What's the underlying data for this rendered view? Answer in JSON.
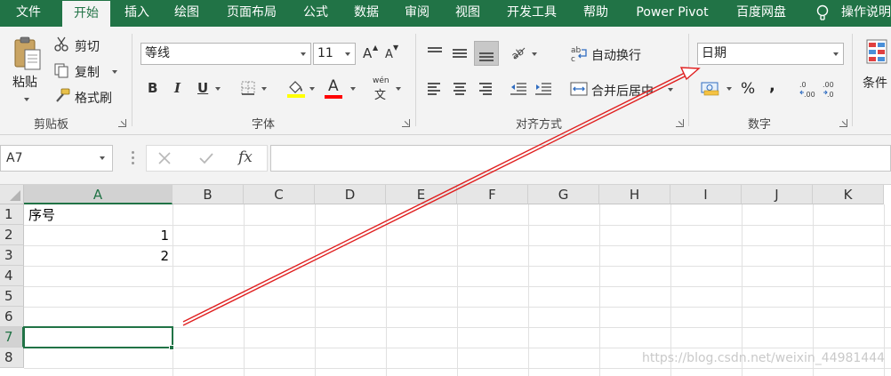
{
  "menu": {
    "tabs": [
      {
        "label": "文件"
      },
      {
        "label": "开始"
      },
      {
        "label": "插入"
      },
      {
        "label": "绘图"
      },
      {
        "label": "页面布局"
      },
      {
        "label": "公式"
      },
      {
        "label": "数据"
      },
      {
        "label": "审阅"
      },
      {
        "label": "视图"
      },
      {
        "label": "开发工具"
      },
      {
        "label": "帮助"
      },
      {
        "label": "Power Pivot"
      },
      {
        "label": "百度网盘"
      }
    ],
    "active_tab": "开始",
    "tell_me": "操作说明",
    "tell_me_icon": "lightbulb-icon"
  },
  "ribbon": {
    "clipboard": {
      "paste_label": "粘贴",
      "cut_label": "剪切",
      "copy_label": "复制",
      "format_painter_label": "格式刷",
      "group_label": "剪贴板"
    },
    "font": {
      "font_name": "等线",
      "font_size": "11",
      "grow_label": "A",
      "shrink_label": "A",
      "bold": "B",
      "italic": "I",
      "underline": "U",
      "font_color_letter": "A",
      "phonetic_top": "wén",
      "phonetic_bottom": "文",
      "highlight_color": "#ffff00",
      "font_color": "#ff0000",
      "group_label": "字体"
    },
    "alignment": {
      "wrap_label": "自动换行",
      "merge_label": "合并后居中",
      "group_label": "对齐方式"
    },
    "number": {
      "format_value": "日期",
      "percent_label": "%",
      "comma_label": ",",
      "group_label": "数字"
    },
    "styles": {
      "conditional_label": "条件"
    }
  },
  "formula_bar": {
    "name_box": "A7",
    "cancel_icon": "close-icon",
    "enter_icon": "check-icon",
    "fx_label": "fx",
    "formula": ""
  },
  "sheet": {
    "columns": [
      "A",
      "B",
      "C",
      "D",
      "E",
      "F",
      "G",
      "H",
      "I",
      "J",
      "K"
    ],
    "rows": [
      "1",
      "2",
      "3",
      "4",
      "5",
      "6",
      "7",
      "8"
    ],
    "selected_column": "A",
    "selected_row": "7",
    "cells": {
      "A1": "序号",
      "A2": "1",
      "A3": "2"
    }
  },
  "watermark": "https://blog.csdn.net/weixin_44981444",
  "colors": {
    "accent": "#217346",
    "annotation_arrow": "#e02020"
  }
}
